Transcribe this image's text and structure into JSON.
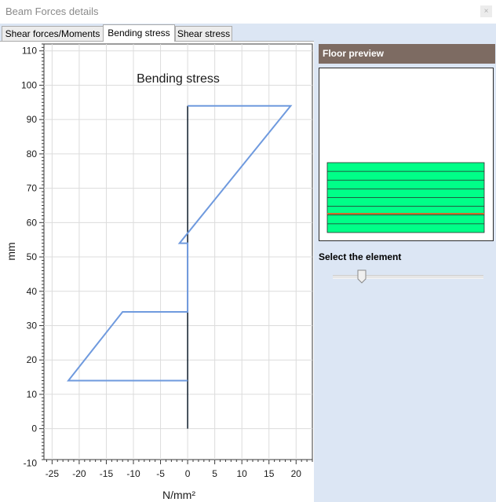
{
  "window": {
    "title": "Beam Forces details",
    "close_icon": "close-icon"
  },
  "tabs": [
    {
      "label": "Shear forces/Moments",
      "active": false
    },
    {
      "label": "Bending stress",
      "active": true
    },
    {
      "label": "Shear stress",
      "active": false
    }
  ],
  "right_panel": {
    "floor_header": "Floor preview",
    "select_label": "Select the element",
    "slider_value_fraction": 0.2,
    "layers_count": 8,
    "highlight_layer_position": 0.73,
    "layer_color": "#00ff88",
    "highlight_color": "#cc6b2b",
    "header_color": "#7d6b62",
    "panel_bg": "#dce6f4"
  },
  "chart_data": {
    "type": "line",
    "title": "Bending stress",
    "xlabel": "N/mm²",
    "ylabel": "mm",
    "xlim": [
      -26.5,
      23
    ],
    "ylim": [
      -9,
      112
    ],
    "x_ticks": [
      -25,
      -20,
      -15,
      -10,
      -5,
      0,
      5,
      10,
      15,
      20
    ],
    "x_tick_labels": [
      "-25",
      "-20",
      "-15",
      "-10",
      "-5",
      "0",
      "5",
      "10",
      "15",
      "20"
    ],
    "y_ticks": [
      0,
      10,
      20,
      30,
      40,
      50,
      60,
      70,
      80,
      90,
      100,
      110
    ],
    "y_tick_labels": [
      "0",
      "10",
      "20",
      "30",
      "40",
      "50",
      "60",
      "70",
      "80",
      "90",
      "100",
      "110"
    ],
    "grid": true,
    "series": [
      {
        "color": "#6f9ade",
        "x": [
          0,
          -22,
          -12,
          0,
          0,
          -1.5,
          19,
          0
        ],
        "y": [
          14,
          14,
          34,
          34,
          54,
          54,
          94,
          94
        ]
      }
    ],
    "axis_line": {
      "color": "#0d1b2a",
      "x": [
        0,
        0
      ],
      "y": [
        0,
        94
      ]
    }
  }
}
